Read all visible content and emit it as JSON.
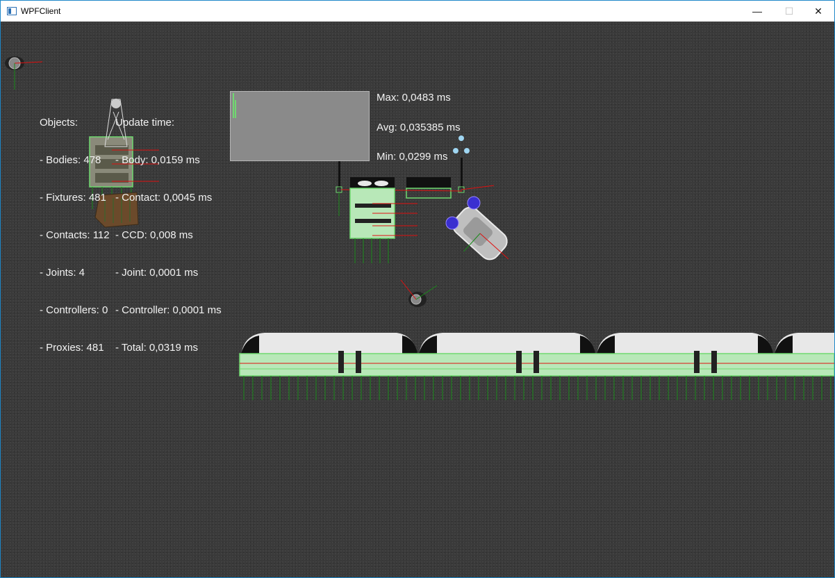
{
  "window": {
    "title": "WPFClient",
    "min_glyph": "—",
    "max_glyph": "☐",
    "close_glyph": "✕"
  },
  "stats": {
    "objects_header": "Objects:",
    "bodies": "- Bodies: 478",
    "fixtures": "- Fixtures: 481",
    "contacts": "- Contacts: 112",
    "joints": "- Joints: 4",
    "controllers": "- Controllers: 0",
    "proxies": "- Proxies: 481",
    "update_header": "Update time:",
    "body_time": "- Body: 0,0159 ms",
    "contact_time": "- Contact: 0,0045 ms",
    "ccd_time": "- CCD: 0,008 ms",
    "joint_time": "- Joint: 0,0001 ms",
    "controller_time": "- Controller: 0,0001 ms",
    "total_time": "- Total: 0,0319 ms"
  },
  "performance_graph": {
    "max": "Max: 0,0483 ms",
    "avg": "Avg: 0,035385 ms",
    "min": "Min: 0,0299 ms"
  },
  "colors": {
    "background": "#3a3a3a",
    "debug_green": "#6fd96f",
    "axis_red": "#e01010",
    "axis_green": "#1a8a1a",
    "joint_blue": "#3a2fd0"
  }
}
